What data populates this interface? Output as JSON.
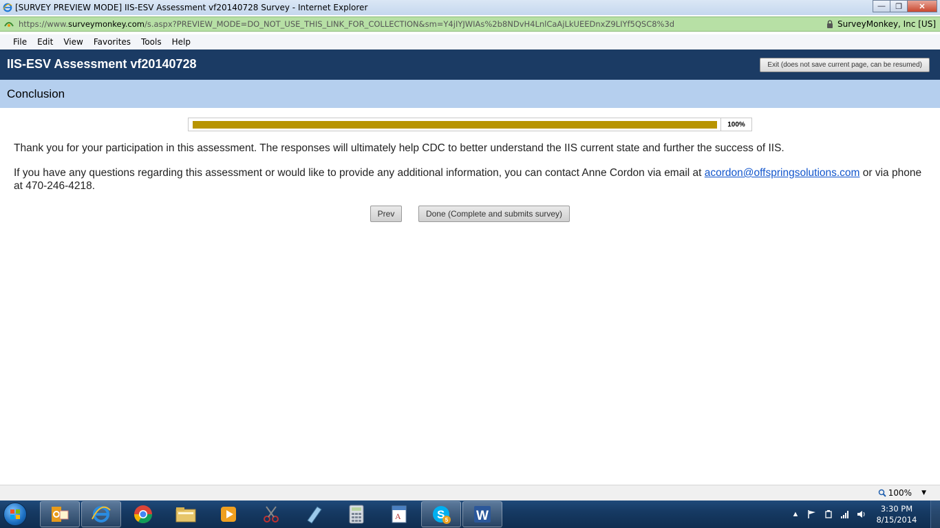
{
  "window": {
    "title": "[SURVEY PREVIEW MODE] IIS-ESV Assessment vf20140728 Survey - Internet Explorer",
    "minimize": "—",
    "maximize": "❐",
    "close": "✕"
  },
  "address_bar": {
    "url_scheme": "https://www.",
    "url_host": "surveymonkey.com",
    "url_path": "/s.aspx?PREVIEW_MODE=DO_NOT_USE_THIS_LINK_FOR_COLLECTION&sm=Y4jIYJWIAs%2b8NDvH4LnlCaAjLkUEEDnxZ9LIYf5QSC8%3d",
    "security_label": "SurveyMonkey, Inc [US]"
  },
  "menu": [
    "File",
    "Edit",
    "View",
    "Favorites",
    "Tools",
    "Help"
  ],
  "survey": {
    "title": "IIS-ESV Assessment vf20140728",
    "exit_label": "Exit (does not save current page, can be resumed)",
    "page_heading": "Conclusion",
    "progress": {
      "value": 1.0,
      "label": "100%"
    },
    "paragraph1": "Thank you for your participation in this assessment. The responses will ultimately help CDC to better understand the IIS current state and further the success of IIS.",
    "paragraph2_before": "If you have any questions regarding this assessment or would like to provide any additional information, you can contact Anne Cordon via email at ",
    "email": "acordon@offspringsolutions.com",
    "paragraph2_after": " or via phone at 470-246-4218.",
    "prev_label": "Prev",
    "done_label": "Done (Complete and submits survey)"
  },
  "status_bar": {
    "zoom": "100%"
  },
  "taskbar": {
    "apps": [
      {
        "name": "outlook",
        "open": true
      },
      {
        "name": "internet-explorer",
        "open": true
      },
      {
        "name": "chrome",
        "open": false
      },
      {
        "name": "file-explorer",
        "open": false
      },
      {
        "name": "media-player",
        "open": false
      },
      {
        "name": "snipping-tool",
        "open": false
      },
      {
        "name": "notepad",
        "open": false
      },
      {
        "name": "calculator",
        "open": false
      },
      {
        "name": "wordpad",
        "open": false
      },
      {
        "name": "skype",
        "open": true,
        "badge": "5"
      },
      {
        "name": "word",
        "open": true
      }
    ],
    "skype_badge": "5",
    "time": "3:30 PM",
    "date": "8/15/2014"
  },
  "colors": {
    "header_bg": "#1b3b64",
    "band_bg": "#b5cfee",
    "progress_fill": "#b89400",
    "link": "#1155cc",
    "address_bar_bg": "#b7e0a5"
  }
}
